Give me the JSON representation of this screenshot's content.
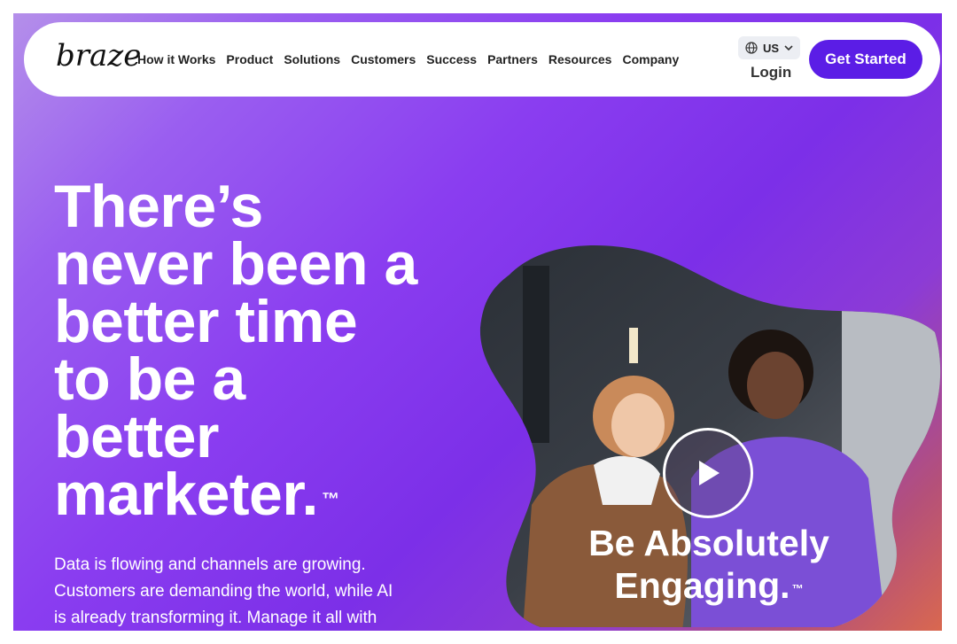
{
  "brand": {
    "logo_text": "braze",
    "primary_color": "#5b1de6"
  },
  "nav": {
    "links": [
      "How it Works",
      "Product",
      "Solutions",
      "Customers",
      "Success",
      "Partners",
      "Resources",
      "Company"
    ],
    "locale": "US",
    "login": "Login",
    "cta": "Get Started"
  },
  "hero": {
    "headline_lines": [
      "There’s",
      "never been a",
      "better time",
      "to be a",
      "better",
      "marketer."
    ],
    "trademark": "™",
    "subtext_lines": [
      "Data is flowing and channels are growing.",
      "Customers are demanding the world, while AI",
      "is already transforming it. Manage it all with"
    ],
    "video": {
      "caption_lines": [
        "Be Absolutely",
        "Engaging."
      ],
      "caption_trademark": "™"
    }
  }
}
